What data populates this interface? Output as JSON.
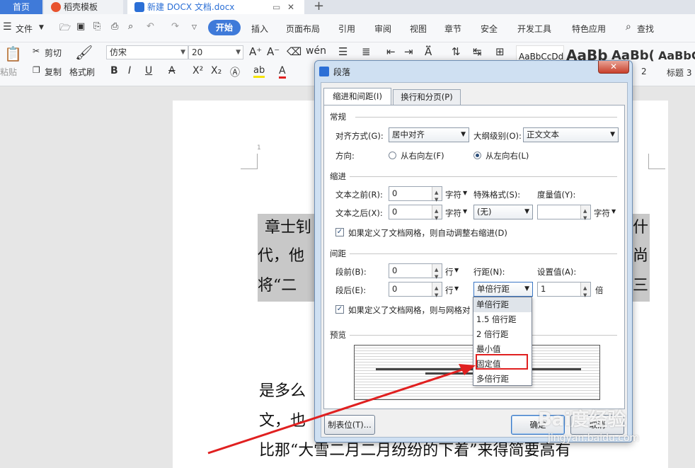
{
  "tabs": {
    "home": "首页",
    "daoke": "稻壳模板",
    "doc": "新建 DOCX 文档.docx"
  },
  "menu": {
    "file": "文件",
    "start": "开始",
    "insert": "插入",
    "layout": "页面布局",
    "reference": "引用",
    "review": "审阅",
    "view": "视图",
    "chapter": "章节",
    "security": "安全",
    "dev": "开发工具",
    "feature": "特色应用",
    "search": "查找"
  },
  "toolbar": {
    "paste": "粘贴",
    "cut": "剪切",
    "copy": "复制",
    "format_painter": "格式刷",
    "font": "仿宋",
    "size": "20",
    "style1": "AaBbCcDd",
    "style2": "AaBb",
    "style3": "AaBb(",
    "style4": "AaBbC",
    "heading2": "2",
    "heading3": "标题 3"
  },
  "document": {
    "page_num": "1",
    "line1a": "章士钊",
    "line1b": "什",
    "line2a": "代，他",
    "line2b": "尚",
    "line3a": "将“二",
    "line3b": "三",
    "line4a": "是多么",
    "line5a": "文，也",
    "line6": "比那“大雪二月二月纷纷的下着”来得简要高有",
    "watermark": "Bai度经验",
    "watermark_url": "jingyan.baidu.com"
  },
  "dialog": {
    "title": "段落",
    "tab_indent": "缩进和间距(I)",
    "tab_page": "换行和分页(P)",
    "general": "常规",
    "align_label": "对齐方式(G):",
    "align_value": "居中对齐",
    "outline_label": "大纲级别(O):",
    "outline_value": "正文文本",
    "direction_label": "方向:",
    "rtl": "从右向左(F)",
    "ltr": "从左向右(L)",
    "indent": "缩进",
    "before_text": "文本之前(R):",
    "before_text_value": "0",
    "unit_char": "字符",
    "special": "特殊格式(S):",
    "special_value": "(无)",
    "measure": "度量值(Y):",
    "after_text": "文本之后(X):",
    "after_text_value": "0",
    "auto_adjust": "如果定义了文档网格，则自动调整右缩进(D)",
    "spacing": "间距",
    "space_before": "段前(B):",
    "space_before_value": "0",
    "unit_line": "行",
    "line_spacing": "行距(N):",
    "line_spacing_value": "单倍行距",
    "set_value": "设置值(A):",
    "set_value_value": "1",
    "unit_times": "倍",
    "space_after": "段后(E):",
    "space_after_value": "0",
    "grid_align": "如果定义了文档网格，则与网格对",
    "preview": "预览",
    "tab_stops": "制表位(T)...",
    "ok": "确定",
    "cancel": "取消",
    "options": [
      "单倍行距",
      "1.5 倍行距",
      "2 倍行距",
      "最小值",
      "固定值",
      "多倍行距"
    ]
  },
  "colors": {
    "accent": "#3f7ad9",
    "annotation": "#e02020"
  }
}
